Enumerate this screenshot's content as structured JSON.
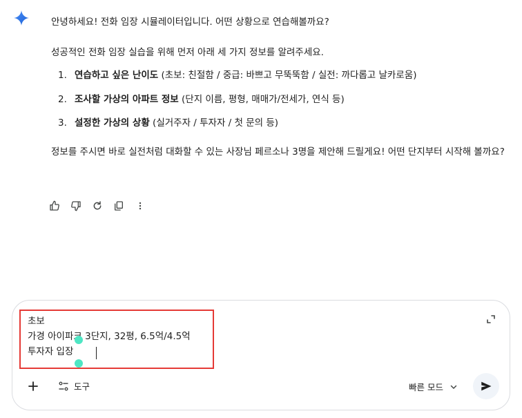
{
  "response": {
    "greeting": "안녕하세요! 전화 임장 시뮬레이터입니다. 어떤 상황으로 연습해볼까요?",
    "intro": "성공적인 전화 임장 실습을 위해 먼저 아래 세 가지 정보를 알려주세요.",
    "items": [
      {
        "num": "1.",
        "bold": "연습하고 싶은 난이도",
        "rest": " (초보: 친절함 / 중급: 바쁘고 무뚝뚝함 / 실전: 까다롭고 날카로움)"
      },
      {
        "num": "2.",
        "bold": "조사할 가상의 아파트 정보",
        "rest": " (단지 이름, 평형, 매매가/전세가, 연식 등)"
      },
      {
        "num": "3.",
        "bold": "설정한 가상의 상황",
        "rest": " (실거주자 / 투자자 / 첫 문의 등)"
      }
    ],
    "closing": "정보를 주시면 바로 실전처럼 대화할 수 있는 사장님 페르소나 3명을 제안해 드릴게요! 어떤 단지부터 시작해 볼까요?"
  },
  "actions": {
    "icons": [
      "thumb-up-icon",
      "thumb-down-icon",
      "refresh-icon",
      "copy-icon",
      "more-vert-icon"
    ]
  },
  "composer": {
    "text": "초보\n가경 아이파크 3단지, 32평, 6.5억/4.5억\n투자자 입장",
    "tools_label": "도구",
    "mode_label": "빠른 모드",
    "accent": "#1a73e8",
    "highlight_color": "#e53935"
  }
}
